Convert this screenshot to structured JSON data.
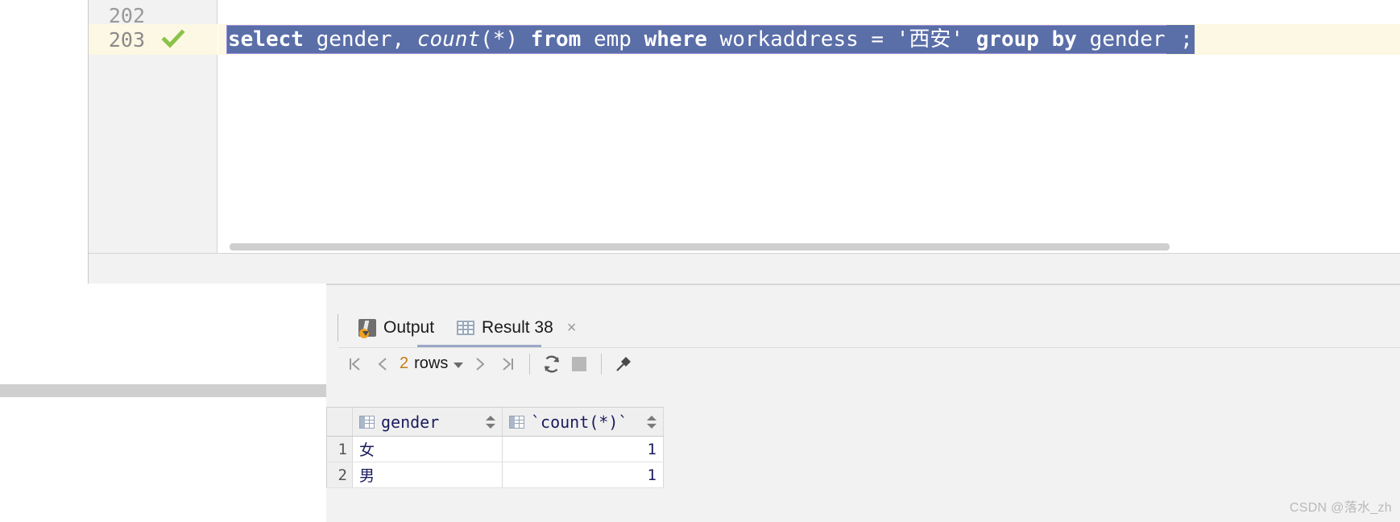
{
  "editor": {
    "lines": [
      {
        "number": "202",
        "current": false,
        "has_run_marker": false
      },
      {
        "number": "203",
        "current": true,
        "has_run_marker": true
      }
    ],
    "run_marker_icon": "check-icon",
    "statement": {
      "selected_text": "select gender, count(*) from emp where workaddress = '西安' group by gender",
      "trailing_text": " ;",
      "tokens": [
        {
          "t": "select",
          "style": "kw"
        },
        {
          "t": " gender, ",
          "style": "plain"
        },
        {
          "t": "count",
          "style": "fn"
        },
        {
          "t": "(*) ",
          "style": "plain"
        },
        {
          "t": "from",
          "style": "kw"
        },
        {
          "t": " emp ",
          "style": "plain"
        },
        {
          "t": "where",
          "style": "kw"
        },
        {
          "t": " workaddress = ",
          "style": "plain"
        },
        {
          "t": "'西安'",
          "style": "str"
        },
        {
          "t": " ",
          "style": "plain"
        },
        {
          "t": "group by",
          "style": "kw"
        },
        {
          "t": " gender",
          "style": "plain"
        }
      ],
      "selection_bg": "#5a6ea8",
      "selection_border": "#9b8fe0",
      "current_line_bg": "#fdf8e3"
    }
  },
  "results": {
    "tabs": [
      {
        "label": "Output",
        "icon": "output-icon",
        "active": false,
        "closable": false
      },
      {
        "label": "Result 38",
        "icon": "grid-icon",
        "active": true,
        "closable": true,
        "close_label": "×"
      }
    ],
    "toolbar": {
      "first_page_label": "|‹",
      "prev_page_label": "‹",
      "rows_count": "2",
      "rows_word": "rows",
      "next_page_label": "›",
      "last_page_label": "›|",
      "reload_icon": "refresh-icon",
      "stop_icon": "stop-icon",
      "pin_icon": "pin-icon"
    },
    "grid": {
      "columns": [
        {
          "label": "gender",
          "icon": "column-icon",
          "sortable": true
        },
        {
          "label": "`count(*)`",
          "icon": "column-icon",
          "sortable": true
        }
      ],
      "rows": [
        {
          "num": "1",
          "gender": "女",
          "count": "1"
        },
        {
          "num": "2",
          "gender": "男",
          "count": "1"
        }
      ]
    }
  },
  "watermark": {
    "text": "CSDN @落水_zh"
  }
}
